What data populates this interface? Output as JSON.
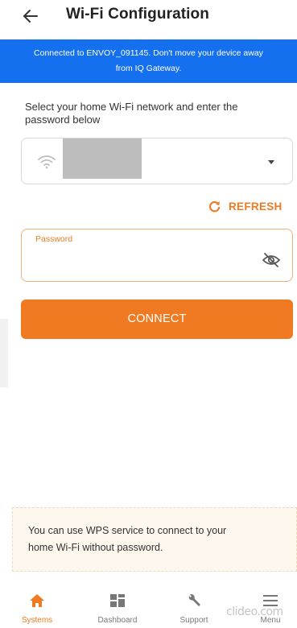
{
  "header": {
    "title": "Wi-Fi Configuration",
    "back_icon": "arrow-left-icon"
  },
  "banner": {
    "line1": "Connected to ENVOY_091145. Don't move your device away",
    "line2": "from IQ Gateway.",
    "color": "#1570ef"
  },
  "form": {
    "instruction": "Select your home Wi-Fi network and enter the password below",
    "network": {
      "icon": "wifi-icon",
      "selected_value": "",
      "caret_icon": "caret-down-icon"
    },
    "refresh_label": "REFRESH",
    "password": {
      "label": "Password",
      "value": "",
      "toggle_icon": "eye-off-icon"
    },
    "connect_label": "CONNECT"
  },
  "wps_notice": {
    "line1": "You can use WPS service to connect to your",
    "line2": "home Wi-Fi without password."
  },
  "bottom_nav": {
    "items": [
      {
        "label": "Systems",
        "icon": "home-icon",
        "active": true
      },
      {
        "label": "Dashboard",
        "icon": "dashboard-icon",
        "active": false
      },
      {
        "label": "Support",
        "icon": "wrench-icon",
        "active": false
      },
      {
        "label": "Menu",
        "icon": "menu-icon",
        "active": false
      }
    ]
  },
  "watermark": "clideo.com",
  "colors": {
    "accent": "#ef7a22",
    "banner": "#1570ef",
    "field_border_focus": "#e9b37d"
  }
}
